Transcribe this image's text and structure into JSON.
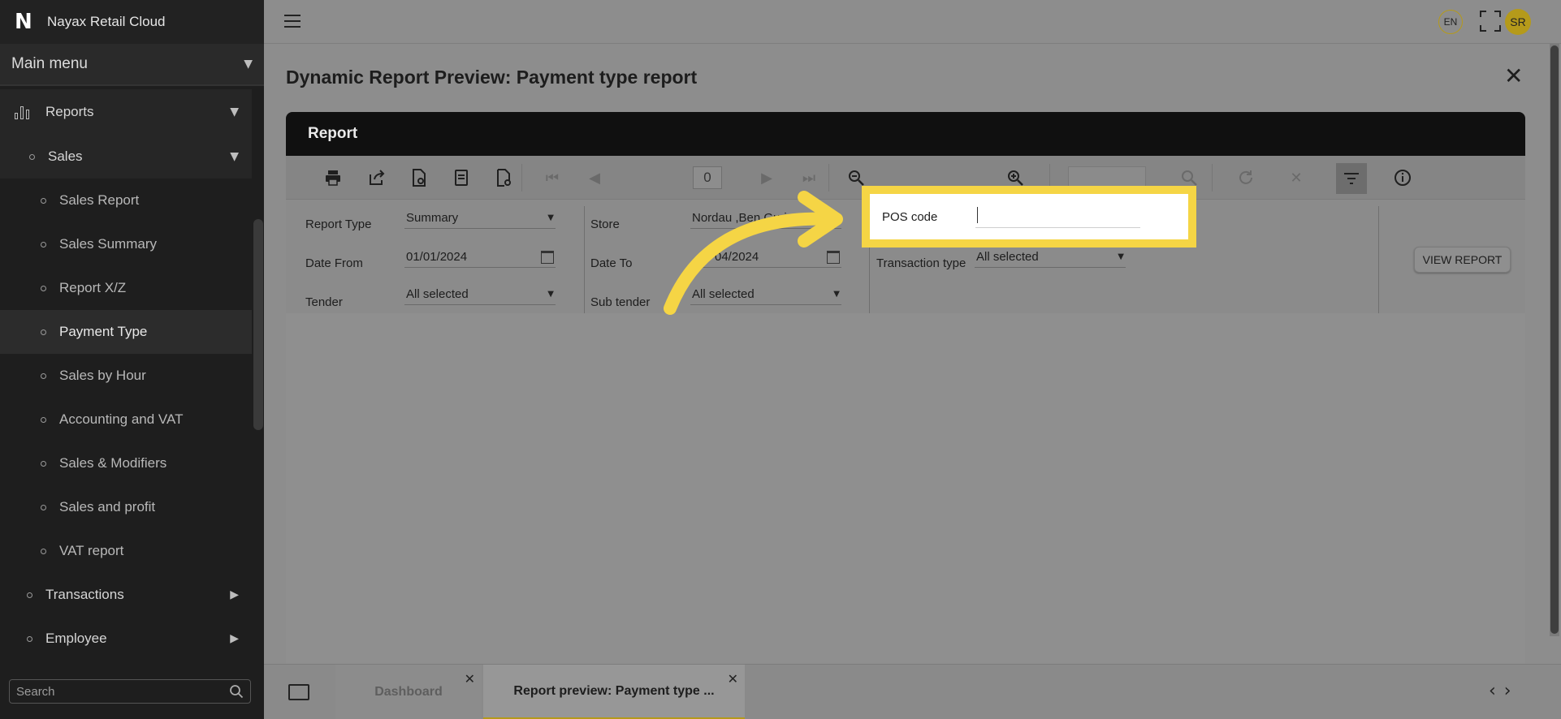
{
  "app": {
    "logo": "N",
    "name": "Nayax Retail Cloud"
  },
  "sidebar": {
    "main_menu_label": "Main menu",
    "reports_label": "Reports",
    "sales_label": "Sales",
    "sales_items": [
      "Sales Report",
      "Sales Summary",
      "Report X/Z",
      "Payment Type",
      "Sales by Hour",
      "Accounting and VAT",
      "Sales & Modifiers",
      "Sales and profit",
      "VAT report"
    ],
    "active_item": "Payment Type",
    "transactions_label": "Transactions",
    "employee_label": "Employee",
    "search_placeholder": "Search"
  },
  "topbar": {
    "lang": "EN",
    "avatar": "SR"
  },
  "page": {
    "title": "Dynamic Report Preview: Payment type report"
  },
  "report": {
    "header": "Report",
    "page_number": "0",
    "params": {
      "report_type_label": "Report Type",
      "report_type_value": "Summary",
      "date_from_label": "Date From",
      "date_from_value": "01/01/2024",
      "tender_label": "Tender",
      "tender_value": "All selected",
      "store_label": "Store",
      "store_value": "Nordau ,Ben Gurion",
      "date_to_label": "Date To",
      "date_to_value": "04/2024",
      "sub_tender_label": "Sub tender",
      "sub_tender_value": "All selected",
      "pos_code_label": "POS code",
      "pos_code_value": "",
      "transaction_type_label": "Transaction type",
      "transaction_type_value": "All selected"
    },
    "view_report_label": "VIEW REPORT"
  },
  "tabs": [
    {
      "label": "Dashboard"
    },
    {
      "label": "Report preview: Payment type ..."
    }
  ],
  "colors": {
    "accent": "#f5d545",
    "gold": "#b59a1a",
    "sidebar": "#1e1e1e"
  }
}
